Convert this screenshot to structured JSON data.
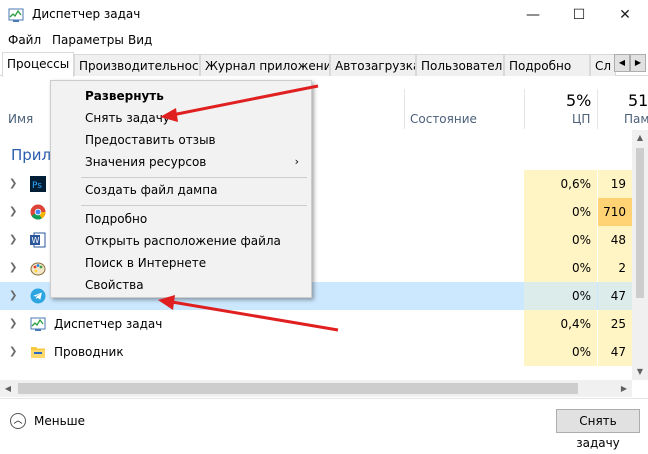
{
  "window": {
    "title": "Диспетчер задач"
  },
  "titlebar": {
    "minimize": "—",
    "maximize": "☐",
    "close": "✕"
  },
  "menu": [
    "Файл",
    "Параметры",
    "Вид"
  ],
  "tabs": [
    {
      "label": "Процессы",
      "active": true
    },
    {
      "label": "Производительность"
    },
    {
      "label": "Журнал приложений"
    },
    {
      "label": "Автозагрузка"
    },
    {
      "label": "Пользователи"
    },
    {
      "label": "Подробно"
    },
    {
      "label": "Сл"
    }
  ],
  "tab_scroll": {
    "left": "◀",
    "right": "▶"
  },
  "columns": {
    "name": "Имя",
    "status": "Состояние",
    "cpu_pct": "5%",
    "cpu": "ЦП",
    "mem_pct": "51",
    "mem": "Памя"
  },
  "group_title": "Прил",
  "rows": [
    {
      "name": "",
      "cpu": "0,6%",
      "mem": "19",
      "icon": "photoshop-icon"
    },
    {
      "name": "",
      "cpu": "0%",
      "mem": "710",
      "icon": "chrome-icon",
      "mem_hot": true
    },
    {
      "name": "",
      "cpu": "0%",
      "mem": "48",
      "icon": "word-icon"
    },
    {
      "name": "",
      "cpu": "0%",
      "mem": "2",
      "icon": "paint-icon"
    },
    {
      "name": "",
      "cpu": "0%",
      "mem": "47",
      "icon": "telegram-icon",
      "selected": true
    },
    {
      "name": "Диспетчер задач",
      "cpu": "0,4%",
      "mem": "25",
      "icon": "task-manager-icon"
    },
    {
      "name": "Проводник",
      "cpu": "0%",
      "mem": "47",
      "icon": "folder-icon"
    }
  ],
  "context_menu": {
    "expand": "Развернуть",
    "end_task": "Снять задачу",
    "feedback": "Предоставить отзыв",
    "resource_values": "Значения ресурсов",
    "dump": "Создать файл дампа",
    "details": "Подробно",
    "open_location": "Открыть расположение файла",
    "search_online": "Поиск в Интернете",
    "properties": "Свойства"
  },
  "footer": {
    "less": "Меньше",
    "end_task_button": "Снять задачу"
  },
  "colors": {
    "accent": "#2c5fad",
    "arrow": "#e02020",
    "cpu_cell": "#fff4c4",
    "mem_hot": "#ffd274",
    "selected_row": "#cce8ff"
  }
}
